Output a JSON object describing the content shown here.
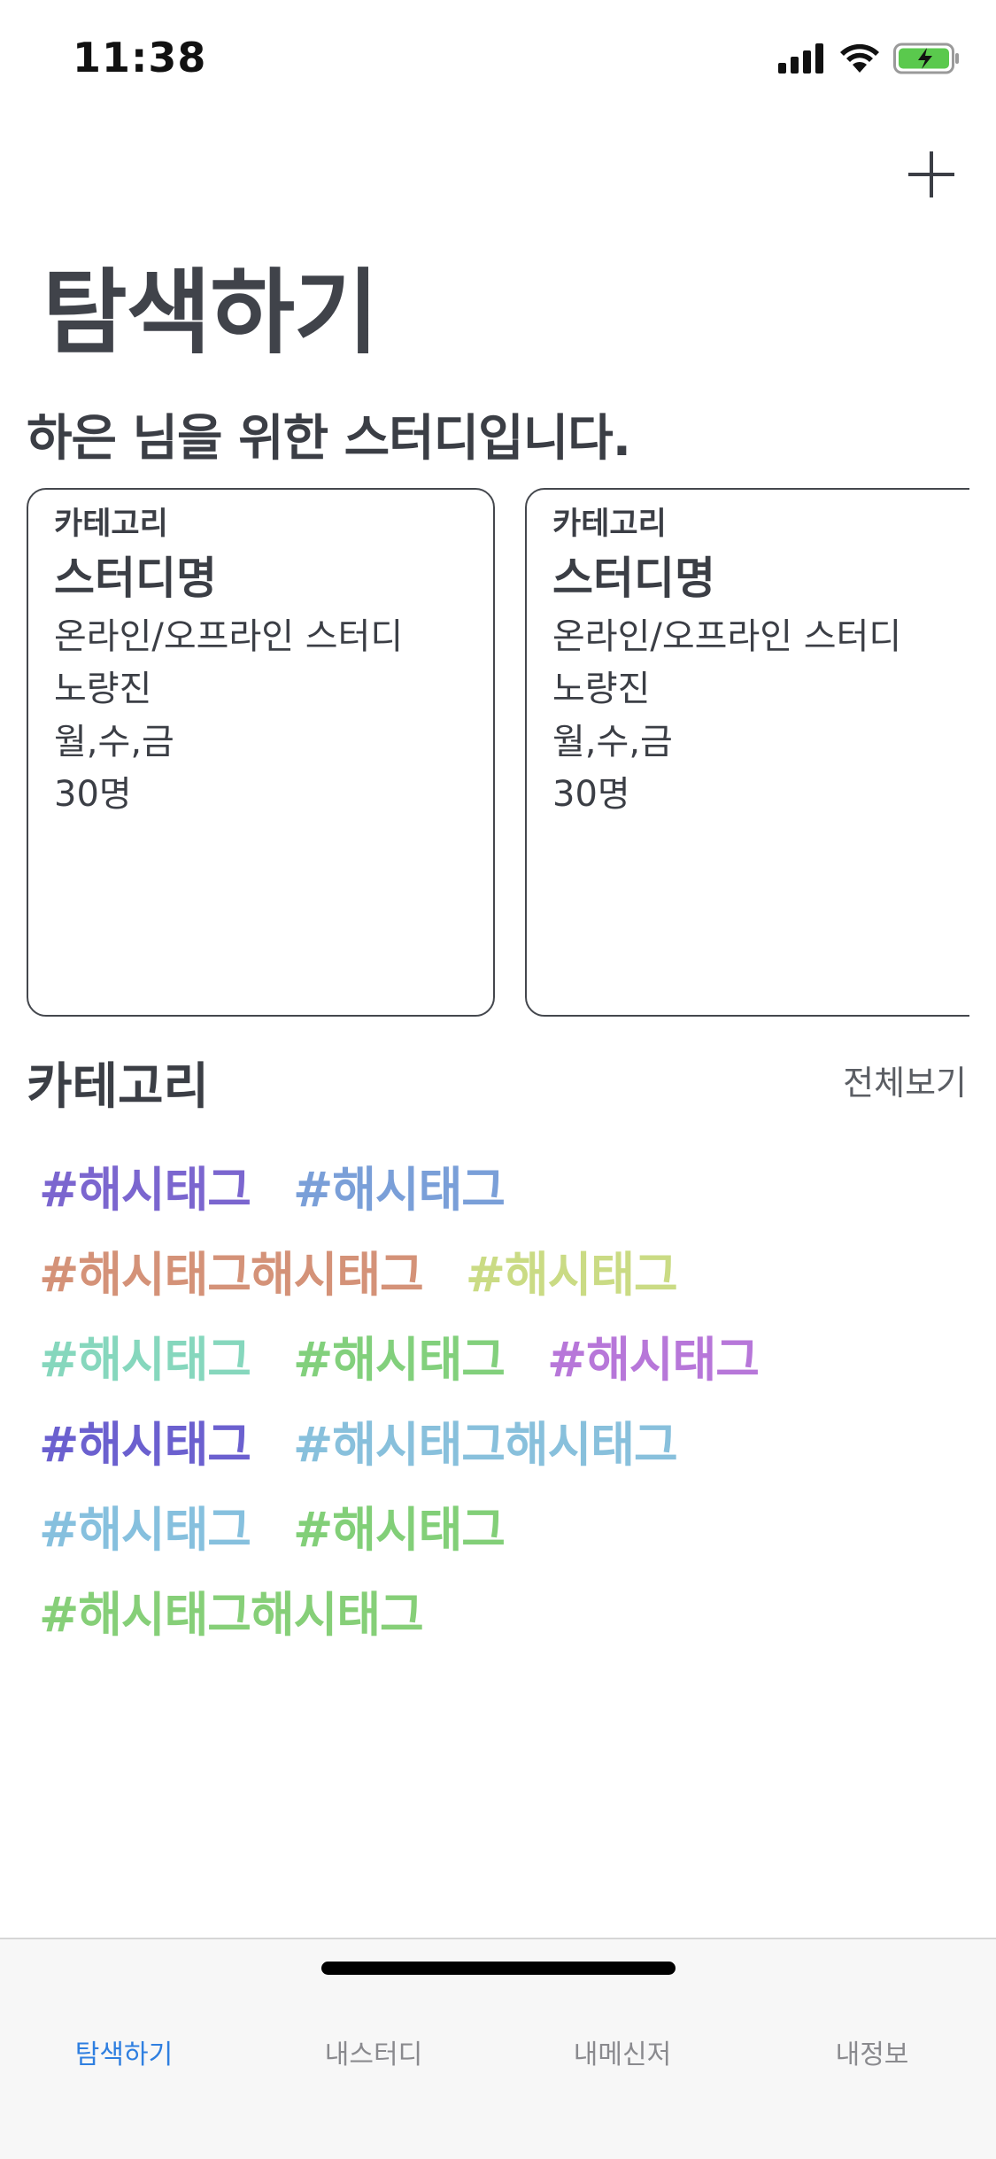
{
  "status_bar": {
    "time": "11:38"
  },
  "header": {
    "title": "탐색하기",
    "add_icon": "plus-icon"
  },
  "recommend": {
    "subtitle": "하은 님을 위한 스터디입니다.",
    "cards": [
      {
        "category": "카테고리",
        "name": "스터디명",
        "mode": "온라인/오프라인 스터디",
        "location": "노량진",
        "days": "월,수,금",
        "capacity": "30명"
      },
      {
        "category": "카테고리",
        "name": "스터디명",
        "mode": "온라인/오프라인 스터디",
        "location": "노량진",
        "days": "월,수,금",
        "capacity": "30명"
      }
    ]
  },
  "category": {
    "title": "카테고리",
    "view_all": "전체보기",
    "rows": [
      [
        {
          "text": "#해시태그",
          "color": "#7b66cf"
        },
        {
          "text": "#해시태그",
          "color": "#7a9fd8"
        }
      ],
      [
        {
          "text": "#해시태그해시태그",
          "color": "#d49278"
        },
        {
          "text": "#해시태그",
          "color": "#cadb84"
        }
      ],
      [
        {
          "text": "#해시태그",
          "color": "#86d7bd"
        },
        {
          "text": "#해시태그",
          "color": "#82d07c"
        },
        {
          "text": "#해시태그",
          "color": "#b777d9"
        }
      ],
      [
        {
          "text": "#해시태그",
          "color": "#6b60cf"
        },
        {
          "text": "#해시태그해시태그",
          "color": "#88c0dc"
        }
      ],
      [
        {
          "text": "#해시태그",
          "color": "#86c0de"
        },
        {
          "text": "#해시태그",
          "color": "#82cf78"
        }
      ],
      [
        {
          "text": "#해시태그해시태그",
          "color": "#86cf78"
        }
      ]
    ]
  },
  "tab_bar": {
    "tabs": [
      {
        "label": "탐색하기",
        "active": true
      },
      {
        "label": "내스터디",
        "active": false
      },
      {
        "label": "내메신저",
        "active": false
      },
      {
        "label": "내정보",
        "active": false
      }
    ],
    "active_color": "#2f7fe0"
  }
}
